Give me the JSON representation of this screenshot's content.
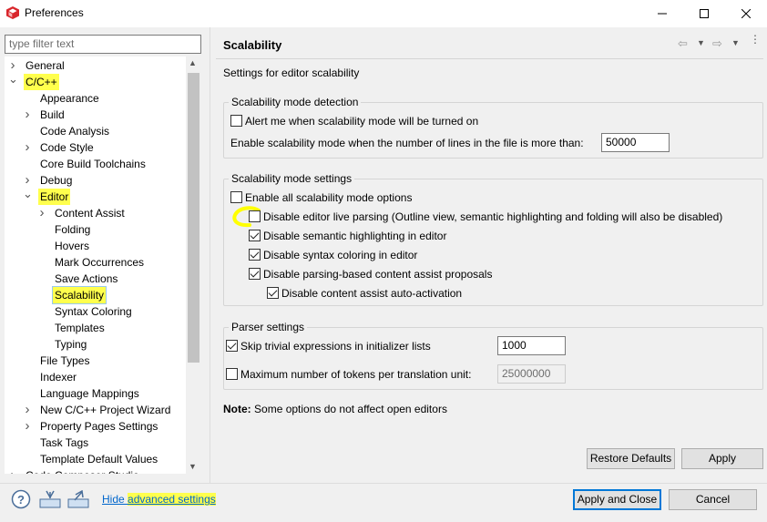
{
  "window": {
    "title": "Preferences",
    "controls": [
      "minimize",
      "maximize",
      "close"
    ]
  },
  "filter": {
    "placeholder": "type filter text"
  },
  "tree": [
    {
      "label": "General",
      "depth": 0,
      "expander": "collapsed"
    },
    {
      "label": "C/C++",
      "depth": 0,
      "expander": "expanded",
      "highlighted": true
    },
    {
      "label": "Appearance",
      "depth": 1,
      "expander": "none"
    },
    {
      "label": "Build",
      "depth": 1,
      "expander": "collapsed"
    },
    {
      "label": "Code Analysis",
      "depth": 1,
      "expander": "none"
    },
    {
      "label": "Code Style",
      "depth": 1,
      "expander": "collapsed"
    },
    {
      "label": "Core Build Toolchains",
      "depth": 1,
      "expander": "none"
    },
    {
      "label": "Debug",
      "depth": 1,
      "expander": "collapsed"
    },
    {
      "label": "Editor",
      "depth": 1,
      "expander": "expanded",
      "highlighted": true
    },
    {
      "label": "Content Assist",
      "depth": 2,
      "expander": "collapsed"
    },
    {
      "label": "Folding",
      "depth": 2,
      "expander": "none"
    },
    {
      "label": "Hovers",
      "depth": 2,
      "expander": "none"
    },
    {
      "label": "Mark Occurrences",
      "depth": 2,
      "expander": "none"
    },
    {
      "label": "Save Actions",
      "depth": 2,
      "expander": "none"
    },
    {
      "label": "Scalability",
      "depth": 2,
      "expander": "none",
      "selected": true,
      "highlighted": true
    },
    {
      "label": "Syntax Coloring",
      "depth": 2,
      "expander": "none"
    },
    {
      "label": "Templates",
      "depth": 2,
      "expander": "none"
    },
    {
      "label": "Typing",
      "depth": 2,
      "expander": "none"
    },
    {
      "label": "File Types",
      "depth": 1,
      "expander": "none"
    },
    {
      "label": "Indexer",
      "depth": 1,
      "expander": "none"
    },
    {
      "label": "Language Mappings",
      "depth": 1,
      "expander": "none"
    },
    {
      "label": "New C/C++ Project Wizard",
      "depth": 1,
      "expander": "collapsed"
    },
    {
      "label": "Property Pages Settings",
      "depth": 1,
      "expander": "collapsed"
    },
    {
      "label": "Task Tags",
      "depth": 1,
      "expander": "none"
    },
    {
      "label": "Template Default Values",
      "depth": 1,
      "expander": "none"
    },
    {
      "label": "Code Composer Studio",
      "depth": 0,
      "expander": "collapsed"
    }
  ],
  "page": {
    "title": "Scalability",
    "description": "Settings for editor scalability",
    "detection": {
      "title": "Scalability mode detection",
      "alert_label": "Alert me when scalability mode will be turned on",
      "alert_checked": false,
      "lines_label": "Enable scalability mode when the number of lines in the file is more than:",
      "lines_value": "50000"
    },
    "mode": {
      "title": "Scalability mode settings",
      "enable_all_label": "Enable all scalability mode options",
      "enable_all_checked": false,
      "options": [
        {
          "label": "Disable editor live parsing (Outline view, semantic highlighting and folding will also be disabled)",
          "checked": false
        },
        {
          "label": "Disable semantic highlighting in editor",
          "checked": true
        },
        {
          "label": "Disable syntax coloring in editor",
          "checked": true
        },
        {
          "label": "Disable parsing-based content assist proposals",
          "checked": true
        }
      ],
      "sub_option": {
        "label": "Disable content assist auto-activation",
        "checked": true
      }
    },
    "parser": {
      "title": "Parser settings",
      "skip_label": "Skip trivial expressions in initializer lists",
      "skip_checked": true,
      "skip_value": "1000",
      "max_tokens_label": "Maximum number of tokens per translation unit:",
      "max_tokens_checked": false,
      "max_tokens_value": "25000000"
    },
    "note_bold": "Note:",
    "note_text": "Some options do not affect open editors",
    "restore_defaults": "Restore Defaults",
    "apply": "Apply"
  },
  "footer": {
    "hide_link_prefix": "Hide ",
    "hide_link_highlight": "advanced settings",
    "apply_and_close": "Apply and Close",
    "cancel": "Cancel"
  },
  "colors": {
    "highlight": "#ffff4d",
    "link": "#0066cc",
    "accent": "#0078d7",
    "app_icon": "#d9262c"
  }
}
